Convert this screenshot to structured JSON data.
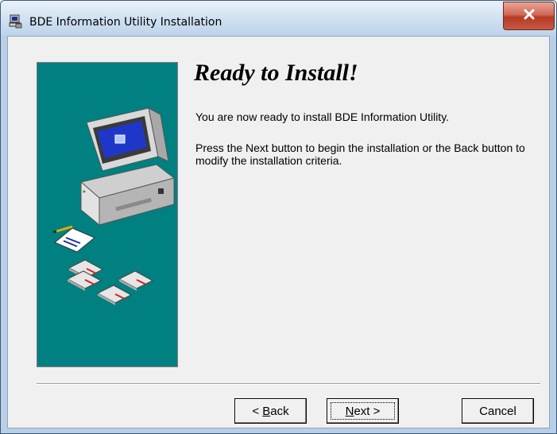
{
  "window": {
    "title": "BDE Information Utility Installation",
    "close_glyph": "x"
  },
  "main": {
    "heading": "Ready to Install!",
    "paragraph1": "You are now ready to install BDE Information Utility.",
    "paragraph2": "Press the Next button to begin the installation or the Back button to modify the installation criteria."
  },
  "buttons": {
    "back": {
      "prefix": "< ",
      "accel": "B",
      "rest": "ack"
    },
    "next": {
      "accel": "N",
      "rest": "ext >"
    },
    "cancel": {
      "label": "Cancel"
    }
  },
  "colors": {
    "banner": "#008080",
    "close_button": "#c7503a",
    "dialog_bg": "#f0f0f0"
  },
  "icons": {
    "app": "installer-computer-icon",
    "banner": "computer-with-disks-illustration",
    "close": "close-icon"
  }
}
